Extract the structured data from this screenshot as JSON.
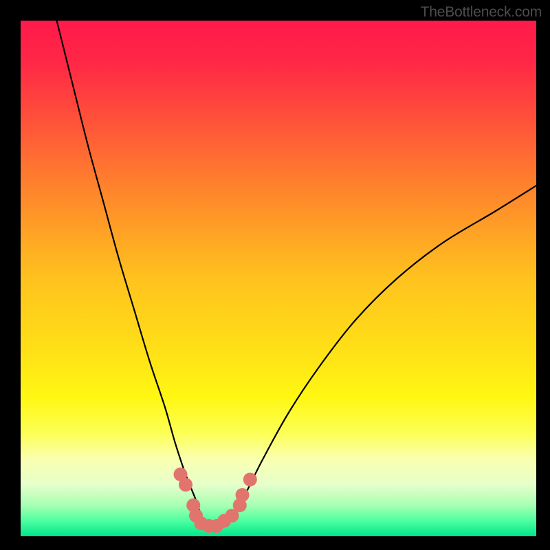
{
  "watermark": "TheBottleneck.com",
  "chart_data": {
    "type": "line",
    "title": "",
    "xlabel": "",
    "ylabel": "",
    "xlim": [
      0,
      100
    ],
    "ylim": [
      0,
      100
    ],
    "gradient_stops": [
      {
        "offset": 0.0,
        "color": "#ff1a4b"
      },
      {
        "offset": 0.08,
        "color": "#ff2746"
      },
      {
        "offset": 0.3,
        "color": "#ff7a2e"
      },
      {
        "offset": 0.5,
        "color": "#ffc21e"
      },
      {
        "offset": 0.66,
        "color": "#ffe516"
      },
      {
        "offset": 0.73,
        "color": "#fff712"
      },
      {
        "offset": 0.8,
        "color": "#fcff55"
      },
      {
        "offset": 0.85,
        "color": "#faffb0"
      },
      {
        "offset": 0.9,
        "color": "#e6ffca"
      },
      {
        "offset": 0.94,
        "color": "#a7ffb3"
      },
      {
        "offset": 0.97,
        "color": "#4dffa0"
      },
      {
        "offset": 1.0,
        "color": "#00e58a"
      }
    ],
    "series": [
      {
        "name": "bottleneck-curve",
        "x": [
          7,
          10,
          13,
          16,
          19,
          22,
          25,
          28,
          30,
          32,
          34,
          35,
          36,
          38,
          40,
          42,
          44,
          47,
          52,
          58,
          65,
          73,
          82,
          92,
          100
        ],
        "y": [
          100,
          88,
          76,
          65,
          54,
          44,
          34,
          25,
          18,
          12,
          7,
          4,
          2,
          2,
          3,
          5,
          9,
          15,
          24,
          33,
          42,
          50,
          57,
          63,
          68
        ]
      }
    ],
    "marker_cluster": {
      "name": "highlight-dots",
      "color": "#e2746e",
      "points": [
        {
          "x": 31.0,
          "y": 12.0
        },
        {
          "x": 32.0,
          "y": 10.0
        },
        {
          "x": 33.5,
          "y": 6.0
        },
        {
          "x": 34.0,
          "y": 4.0
        },
        {
          "x": 35.0,
          "y": 2.5
        },
        {
          "x": 36.5,
          "y": 2.0
        },
        {
          "x": 38.0,
          "y": 2.0
        },
        {
          "x": 39.5,
          "y": 3.0
        },
        {
          "x": 41.0,
          "y": 4.0
        },
        {
          "x": 42.5,
          "y": 6.0
        },
        {
          "x": 43.0,
          "y": 8.0
        },
        {
          "x": 44.5,
          "y": 11.0
        }
      ]
    }
  }
}
